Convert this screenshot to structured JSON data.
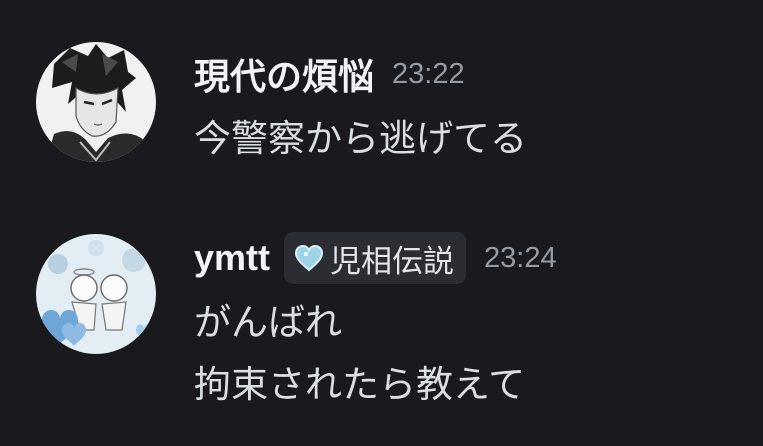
{
  "messages": [
    {
      "author": "現代の煩悩",
      "timestamp": "23:22",
      "lines": [
        "今警察から逃げてる"
      ]
    },
    {
      "author": "ymtt",
      "tag": {
        "icon": "heart-icon",
        "label": "児相伝説"
      },
      "timestamp": "23:24",
      "lines": [
        "がんばれ",
        "拘束されたら教えて"
      ]
    }
  ],
  "colors": {
    "background": "#1a1a1e",
    "username": "#f2f3f5",
    "message_text": "#dbdee1",
    "timestamp": "#949ba4",
    "tag_background": "#2b2d33",
    "heart_tag": "#9fd4e4"
  }
}
